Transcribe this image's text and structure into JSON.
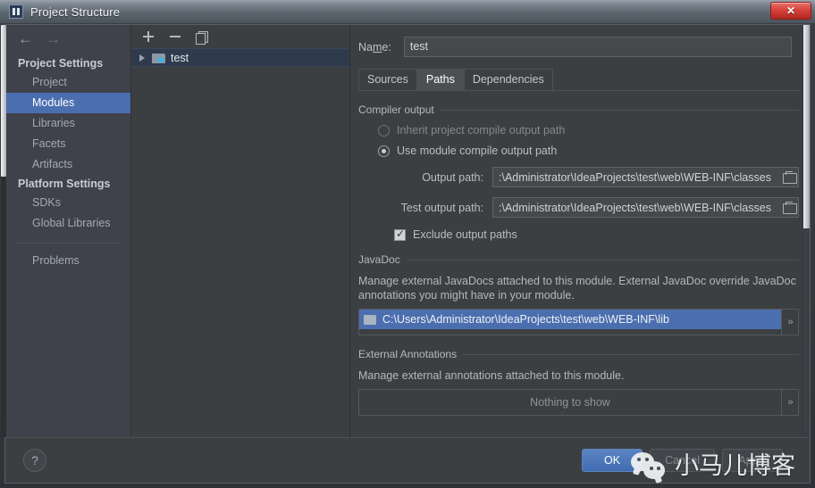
{
  "window": {
    "title": "Project Structure",
    "app_icon": "intellij-idea-icon",
    "close_label": "✕"
  },
  "sidebar": {
    "back_icon": "←",
    "forward_icon": "→",
    "sections": [
      {
        "header": "Project Settings",
        "items": [
          "Project",
          "Modules",
          "Libraries",
          "Facets",
          "Artifacts"
        ]
      },
      {
        "header": "Platform Settings",
        "items": [
          "SDKs",
          "Global Libraries"
        ]
      }
    ],
    "selected": "Modules",
    "extra_items": [
      "Problems"
    ]
  },
  "tree": {
    "toolbar": {
      "add_label": "+",
      "remove_label": "−",
      "copy_label": "copy"
    },
    "nodes": [
      {
        "label": "test",
        "expanded": false,
        "selected": true
      }
    ]
  },
  "content": {
    "name_label_pre": "Na",
    "name_label_mnemonic": "m",
    "name_label_post": "e:",
    "name_value": "test",
    "tabs": [
      {
        "label": "Sources",
        "active": false
      },
      {
        "label": "Paths",
        "active": true
      },
      {
        "label": "Dependencies",
        "active": false
      }
    ],
    "compiler_output": {
      "title": "Compiler output",
      "option_inherit": "Inherit project compile output path",
      "option_module": "Use module compile output path",
      "selected": "module",
      "output_path_label": "Output path:",
      "output_path_value": ":\\Administrator\\IdeaProjects\\test\\web\\WEB-INF\\classes",
      "test_output_path_label": "Test output path:",
      "test_output_path_value": ":\\Administrator\\IdeaProjects\\test\\web\\WEB-INF\\classes",
      "exclude_label": "Exclude output paths",
      "exclude_checked": true
    },
    "javadoc": {
      "title": "JavaDoc",
      "description": "Manage external JavaDocs attached to this module. External JavaDoc override JavaDoc annotations you might have in your module.",
      "entries": [
        "C:\\Users\\Administrator\\IdeaProjects\\test\\web\\WEB-INF\\lib"
      ],
      "expand_label": "»"
    },
    "external_annotations": {
      "title": "External Annotations",
      "description": "Manage external annotations attached to this module.",
      "empty_text": "Nothing to show",
      "expand_label": "»"
    }
  },
  "footer": {
    "help_label": "?",
    "ok_label": "OK",
    "cancel_label": "Cancel",
    "apply_label": "Apply"
  },
  "watermark": {
    "text": "小马儿博客",
    "logo": "wechat-icon"
  },
  "colors": {
    "accent_blue": "#4b6eaf",
    "panel_bg": "#3c3f41",
    "sidebar_bg": "#3f424b",
    "close_red": "#d6433c"
  }
}
